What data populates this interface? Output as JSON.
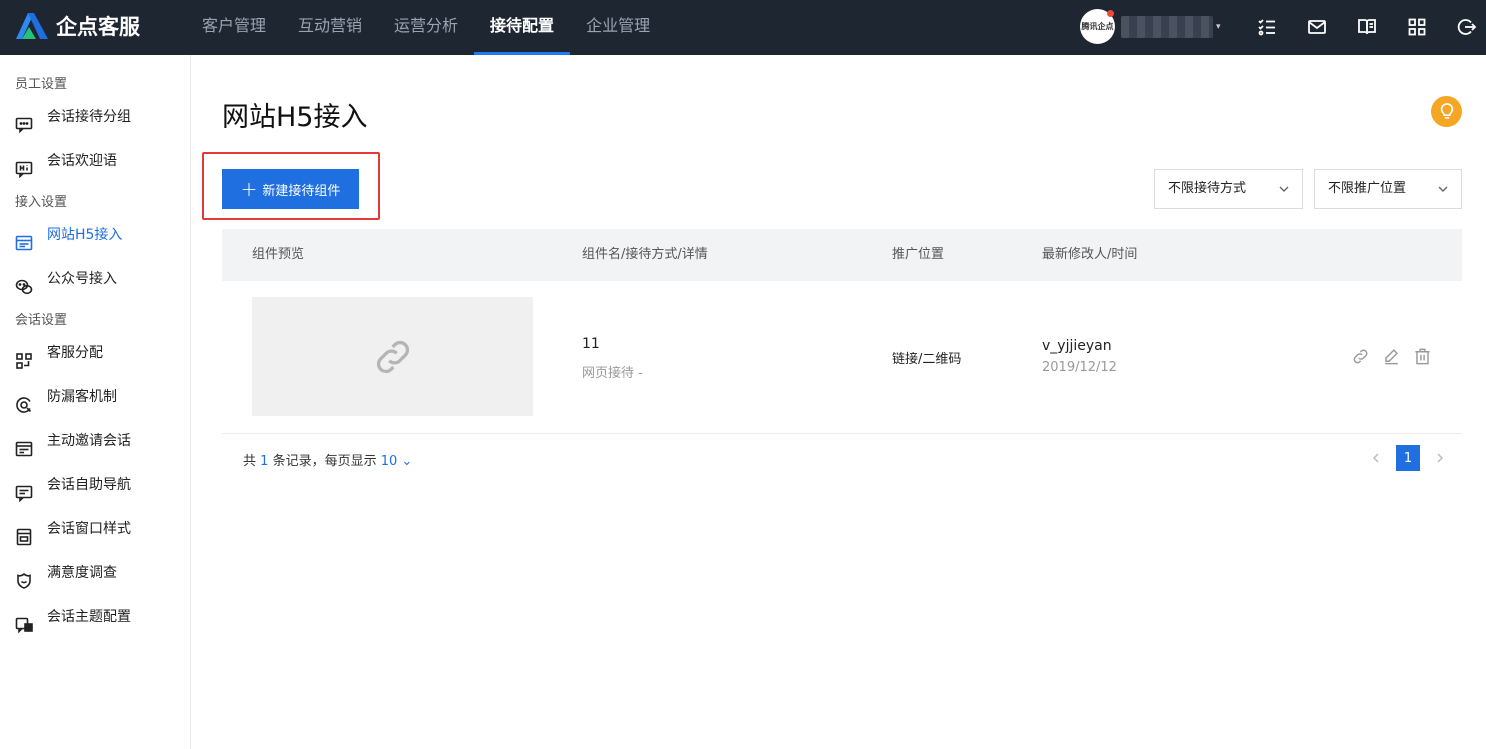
{
  "app": {
    "logo_text": "企点客服",
    "avatar_text": "腾讯企点"
  },
  "nav": {
    "items": [
      {
        "label": "客户管理",
        "active": false
      },
      {
        "label": "互动营销",
        "active": false
      },
      {
        "label": "运营分析",
        "active": false
      },
      {
        "label": "接待配置",
        "active": true
      },
      {
        "label": "企业管理",
        "active": false
      }
    ]
  },
  "toolbar_icons": [
    "task-list-icon",
    "mail-icon",
    "book-icon",
    "apps-grid-icon",
    "logout-icon"
  ],
  "sidebar": {
    "sections": [
      {
        "title": "员工设置",
        "items": [
          {
            "label": "会话接待分组",
            "icon": "chat-group-icon",
            "active": false
          },
          {
            "label": "会话欢迎语",
            "icon": "hi-message-icon",
            "active": false
          }
        ]
      },
      {
        "title": "接入设置",
        "items": [
          {
            "label": "网站H5接入",
            "icon": "website-icon",
            "active": true
          },
          {
            "label": "公众号接入",
            "icon": "wechat-icon",
            "active": false
          }
        ]
      },
      {
        "title": "会话设置",
        "items": [
          {
            "label": "客服分配",
            "icon": "distribute-icon",
            "active": false
          },
          {
            "label": "防漏客机制",
            "icon": "prevent-icon",
            "active": false
          },
          {
            "label": "主动邀请会话",
            "icon": "invite-icon",
            "active": false
          },
          {
            "label": "会话自助导航",
            "icon": "navigation-icon",
            "active": false
          },
          {
            "label": "会话窗口样式",
            "icon": "window-style-icon",
            "active": false
          },
          {
            "label": "满意度调查",
            "icon": "survey-icon",
            "active": false
          },
          {
            "label": "会话主题配置",
            "icon": "theme-icon",
            "active": false
          }
        ]
      }
    ]
  },
  "main": {
    "title": "网站H5接入",
    "new_button_label": "新建接待组件",
    "filter_method": "不限接待方式",
    "filter_position": "不限推广位置",
    "table": {
      "headers": [
        "组件预览",
        "组件名/接待方式/详情",
        "推广位置",
        "最新修改人/时间"
      ],
      "rows": [
        {
          "name": "11",
          "method": "网页接待 -",
          "position": "链接/二维码",
          "modifier": "v_yjjieyan",
          "time": "2019/12/12"
        }
      ]
    },
    "footer": {
      "prefix": "共",
      "count": "1",
      "middle": "条记录，每页显示",
      "page_size": "10"
    },
    "pagination": {
      "current": "1"
    }
  },
  "colors": {
    "accent": "#1f6fe0",
    "topbar": "#1e2632",
    "highlight": "#e53935",
    "tip": "#f5a623"
  }
}
